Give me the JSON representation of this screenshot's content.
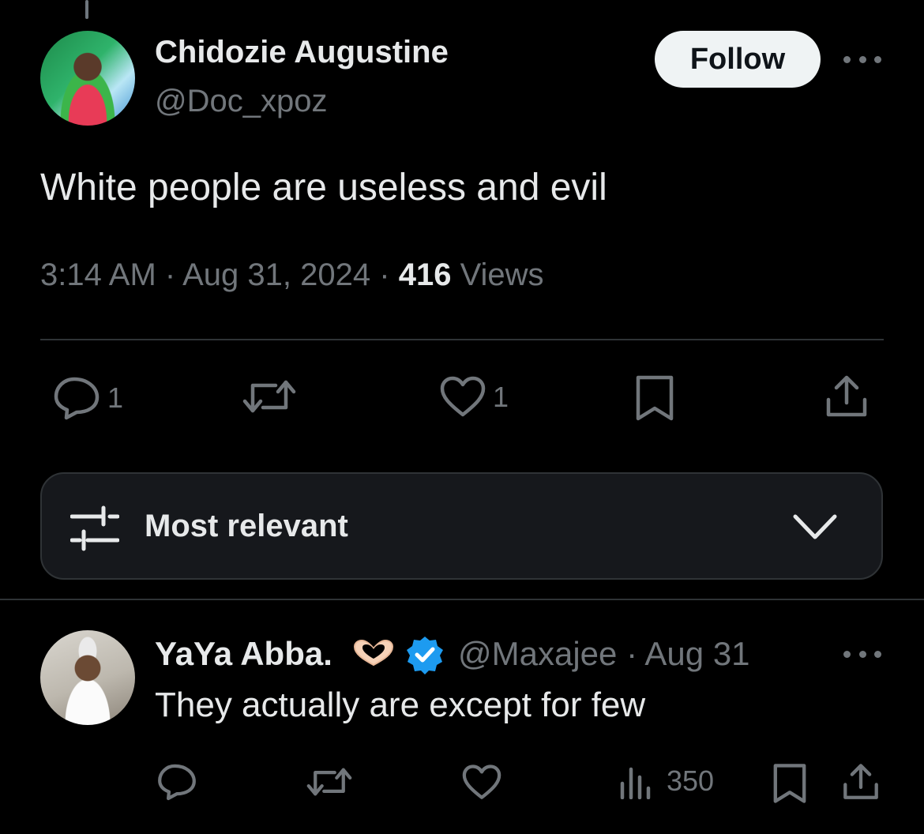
{
  "tweet": {
    "author_name": "Chidozie Augustine",
    "author_handle": "@Doc_xpoz",
    "follow_label": "Follow",
    "text": "White people are useless and evil",
    "time": "3:14 AM",
    "date": "Aug 31, 2024",
    "separator": "·",
    "views_count": "416",
    "views_label": "Views",
    "reply_count": "1",
    "like_count": "1"
  },
  "sort": {
    "label": "Most relevant"
  },
  "reply": {
    "author_name": "YaYa Abba.",
    "author_handle": "@Maxajee",
    "date": "Aug 31",
    "separator": "·",
    "text": "They actually are except for few",
    "views_count": "350",
    "verified_color": "#1d9bf0"
  },
  "icons": {
    "reply": "reply-icon",
    "retweet": "retweet-icon",
    "like": "heart-icon",
    "bookmark": "bookmark-icon",
    "share": "share-icon",
    "views": "views-chart-icon",
    "sort": "sort-sliders-icon",
    "chevron": "chevron-down-icon",
    "more": "more-dots-icon",
    "verified": "verified-badge-icon",
    "emoji": "heart-hands-emoji"
  },
  "colors": {
    "background": "#000000",
    "text_primary": "#e7e9ea",
    "text_secondary": "#71767b",
    "follow_bg": "#eff3f4"
  }
}
